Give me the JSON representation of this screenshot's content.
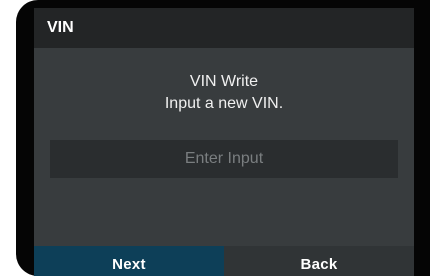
{
  "dialog": {
    "title": "VIN",
    "heading": "VIN Write",
    "prompt": "Input a new VIN.",
    "input": {
      "value": "",
      "placeholder": "Enter Input"
    }
  },
  "buttons": {
    "next_label": "Next",
    "back_label": "Back"
  },
  "colors": {
    "title_bar": "#232526",
    "content_bg": "#383c3e",
    "input_bg": "#2a2d2f",
    "primary_button": "#0d3f58",
    "secondary_button": "#303436",
    "bezel": "#050505"
  }
}
